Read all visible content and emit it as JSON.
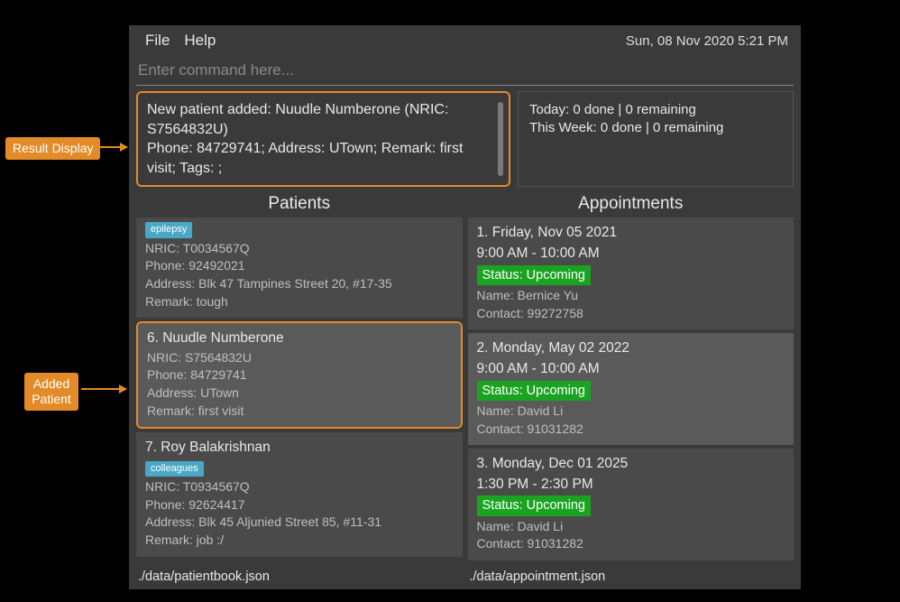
{
  "callouts": {
    "result_display": "Result Display",
    "added_patient_line1": "Added",
    "added_patient_line2": "Patient"
  },
  "menubar": {
    "file": "File",
    "help": "Help",
    "datetime": "Sun, 08 Nov 2020 5:21 PM"
  },
  "command": {
    "placeholder": "Enter command here..."
  },
  "result": {
    "line1": "New patient added: Nuudle Numberone (NRIC: S7564832U)",
    "line2": "Phone: 84729741; Address: UTown; Remark: first visit; Tags: ;"
  },
  "stats": {
    "today": "Today: 0 done | 0 remaining",
    "week": "This Week: 0 done | 0 remaining"
  },
  "patients": {
    "title": "Patients",
    "items": [
      {
        "partial": true,
        "tag": "epilepsy",
        "tag_color": "#4aa8c7",
        "nric": "NRIC: T0034567Q",
        "phone": "Phone: 92492021",
        "address": "Address: Blk 47 Tampines Street 20, #17-35",
        "remark": "Remark: tough"
      },
      {
        "highlighted": true,
        "selected": true,
        "title": "6.  Nuudle Numberone",
        "nric": "NRIC: S7564832U",
        "phone": "Phone: 84729741",
        "address": "Address: UTown",
        "remark": "Remark: first visit"
      },
      {
        "title": "7.  Roy Balakrishnan",
        "tag": "colleagues",
        "tag_color": "#4aa8c7",
        "nric": "NRIC: T0934567Q",
        "phone": "Phone: 92624417",
        "address": "Address: Blk 45 Aljunied Street 85, #11-31",
        "remark": "Remark: job :/"
      }
    ]
  },
  "appointments": {
    "title": "Appointments",
    "items": [
      {
        "title": "1.  Friday, Nov 05 2021",
        "time": "9:00 AM - 10:00 AM",
        "status": "Status: Upcoming",
        "name": "Name: Bernice Yu",
        "contact": "Contact: 99272758"
      },
      {
        "selected": true,
        "title": "2.  Monday, May 02 2022",
        "time": "9:00 AM - 10:00 AM",
        "status": "Status: Upcoming",
        "name": "Name: David Li",
        "contact": "Contact: 91031282"
      },
      {
        "title": "3.  Monday, Dec 01 2025",
        "time": "1:30 PM - 2:30 PM",
        "status": "Status: Upcoming",
        "name": "Name: David Li",
        "contact": "Contact: 91031282"
      }
    ]
  },
  "footer": {
    "left": "./data/patientbook.json",
    "right": "./data/appointment.json"
  }
}
